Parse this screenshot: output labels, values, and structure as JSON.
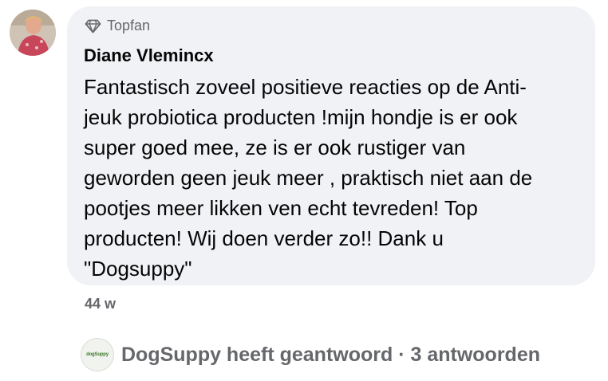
{
  "comment": {
    "badge_label": "Topfan",
    "author_name": "Diane Vlemincx",
    "text": "Fantastisch zoveel positieve reacties op de Anti-\njeuk probiotica producten !mijn hondje is er ook\nsuper goed mee, ze is er ook rustiger van\ngeworden geen jeuk meer , praktisch niet aan de\npootjes meer likken ven echt tevreden! Top\nproducten! Wij doen verder zo!! Dank u\n\"Dogsuppy\"",
    "timestamp": "44 w"
  },
  "replies": {
    "summary": "DogSuppy heeft geantwoord · 3 antwoorden",
    "replier_logo_text": "dogSuppy"
  },
  "icons": {
    "badge": "diamond-icon"
  },
  "colors": {
    "bubble": "#f0f2f5",
    "text": "#050505",
    "secondary_text": "#65676b"
  }
}
